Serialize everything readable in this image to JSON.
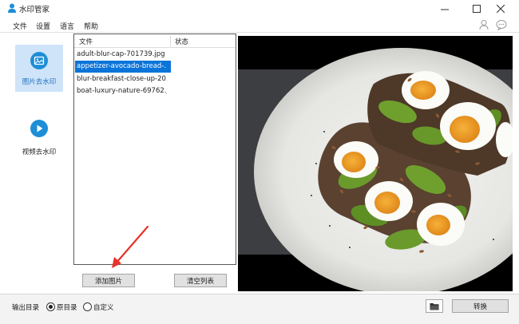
{
  "window": {
    "title": "水印管家",
    "controls": [
      "minimize-icon",
      "maximize-icon",
      "close-icon"
    ]
  },
  "menu": {
    "items": [
      "文件",
      "设置",
      "语言",
      "帮助"
    ],
    "right_icons": [
      "user-icon",
      "chat-icon"
    ]
  },
  "sidebar": {
    "items": [
      {
        "label": "图片去水印",
        "icon": "image-icon",
        "active": true
      },
      {
        "label": "视频去水印",
        "icon": "video-play-icon",
        "active": false
      }
    ]
  },
  "file_list": {
    "columns": [
      "文件",
      "状态"
    ],
    "rows": [
      {
        "name": "adult-blur-cap-701739.jpg",
        "status": ""
      },
      {
        "name": "appetizer-avocado-bread-...",
        "status": "",
        "selected": true
      },
      {
        "name": "blur-breakfast-close-up-20...",
        "status": ""
      },
      {
        "name": "boat-luxury-nature-69762.j...",
        "status": ""
      }
    ],
    "add_button": "添加图片",
    "clear_button": "清空列表"
  },
  "preview": {
    "subject": "avocado-egg-toast-photo"
  },
  "output": {
    "label": "输出目录",
    "options": [
      {
        "label": "原目录",
        "checked": true
      },
      {
        "label": "自定义",
        "checked": false
      }
    ],
    "folder_icon": "folder-icon",
    "convert_button": "转换"
  },
  "colors": {
    "accent": "#0a74d9",
    "nav_active_bg": "#cfe4f9",
    "icon_blue": "#1e8ed6",
    "annotation_arrow": "#e8322b"
  }
}
